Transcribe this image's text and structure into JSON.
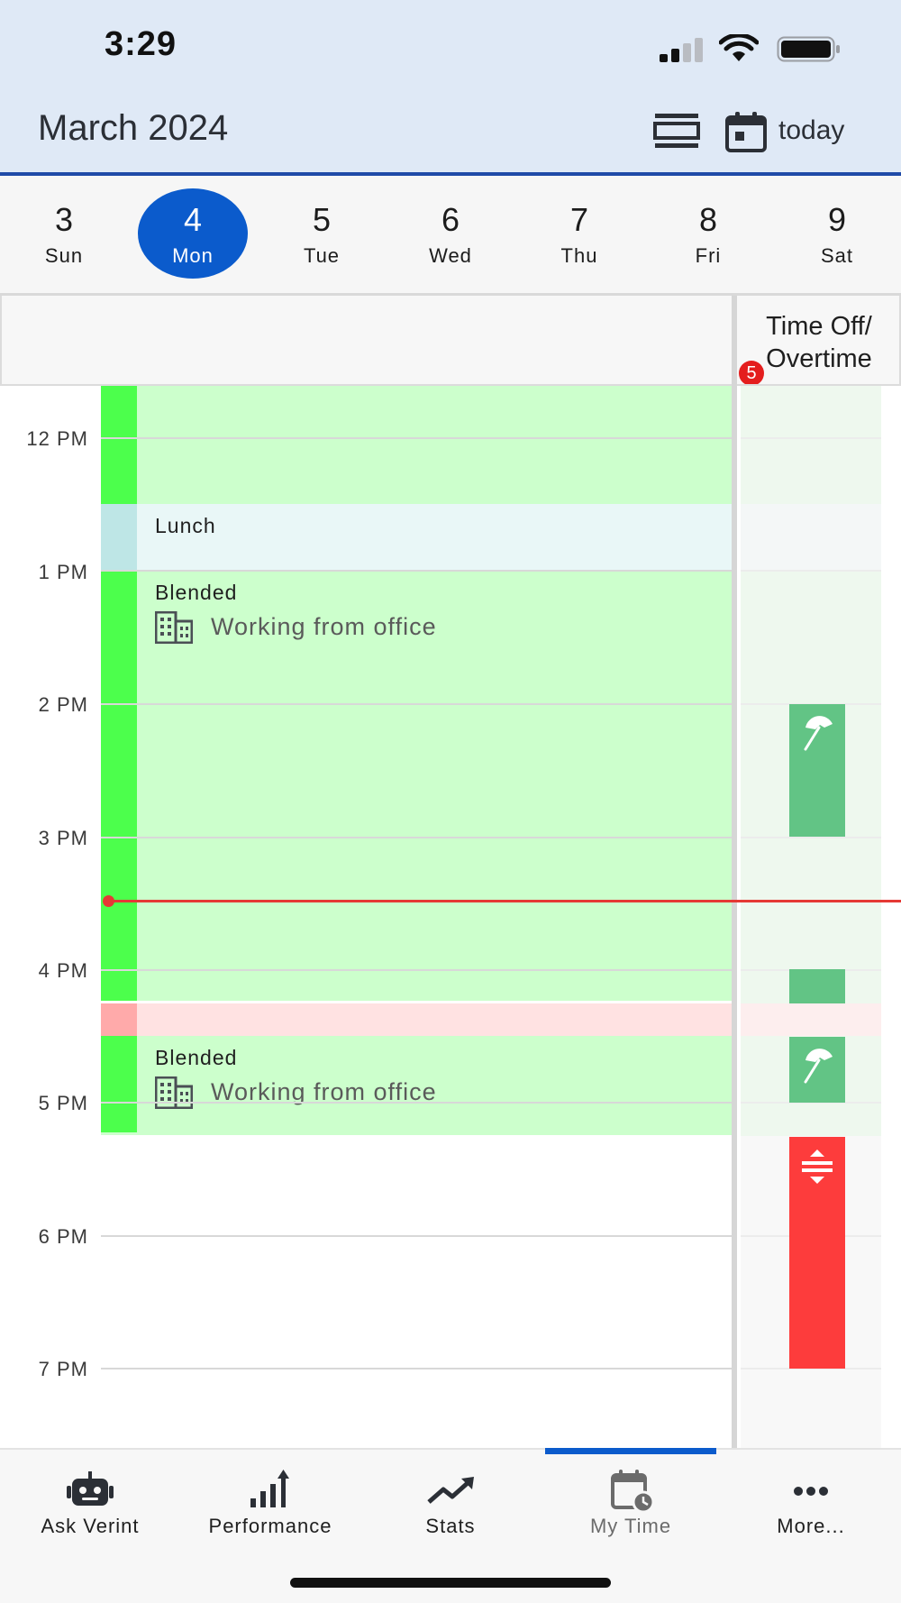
{
  "status_bar": {
    "time": "3:29"
  },
  "header": {
    "title": "March 2024",
    "today_label": "today"
  },
  "week": [
    {
      "num": "3",
      "dow": "Sun",
      "selected": false
    },
    {
      "num": "4",
      "dow": "Mon",
      "selected": true
    },
    {
      "num": "5",
      "dow": "Tue",
      "selected": false
    },
    {
      "num": "6",
      "dow": "Wed",
      "selected": false
    },
    {
      "num": "7",
      "dow": "Thu",
      "selected": false
    },
    {
      "num": "8",
      "dow": "Fri",
      "selected": false
    },
    {
      "num": "9",
      "dow": "Sat",
      "selected": false
    }
  ],
  "columns": {
    "time_off_line1": "Time Off/",
    "time_off_line2": "Overtime",
    "badge_count": "5"
  },
  "hours": [
    "12 PM",
    "1 PM",
    "2 PM",
    "3 PM",
    "4 PM",
    "5 PM",
    "6 PM",
    "7 PM"
  ],
  "events": {
    "lunch_label": "Lunch",
    "blended_1_title": "Blended",
    "blended_1_sub": "Working from office",
    "blended_2_title": "Blended",
    "blended_2_sub": "Working from office"
  },
  "colors": {
    "accent": "#0b5bcc",
    "work_bg": "#ccffcc",
    "work_stripe": "#4cff4c",
    "lunch_bg": "#e9f7f7",
    "lunch_stripe": "#bee6e6",
    "break_bg": "#ffe2e2",
    "break_stripe": "#ffaaaa",
    "time_off": "#62c485",
    "overtime": "#fd3c3c",
    "now_line": "#e53935"
  },
  "nav": [
    {
      "label": "Ask Verint",
      "icon": "robot-icon"
    },
    {
      "label": "Performance",
      "icon": "bar-chart-up-icon"
    },
    {
      "label": "Stats",
      "icon": "trend-line-icon"
    },
    {
      "label": "My Time",
      "icon": "calendar-clock-icon",
      "active": true
    },
    {
      "label": "More...",
      "icon": "more-dots-icon"
    }
  ]
}
